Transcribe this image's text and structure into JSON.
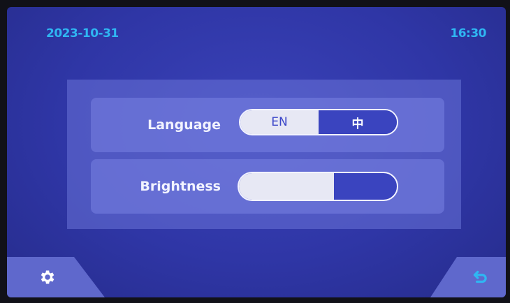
{
  "status_bar": {
    "date": "2023-10-31",
    "time": "16:30"
  },
  "settings": {
    "language": {
      "label": "Language",
      "options": [
        "EN",
        "中"
      ],
      "selected": "中"
    },
    "brightness": {
      "label": "Brightness",
      "level": 0.6
    }
  },
  "bottom_bar": {
    "left_icon": "gear-icon",
    "right_icon": "back-arrow-icon"
  },
  "colors": {
    "background": "#2f36a6",
    "accent_text": "#2fb6f2",
    "selected_option": "#3a44bf",
    "unselected_option": "#e7e8f4"
  }
}
